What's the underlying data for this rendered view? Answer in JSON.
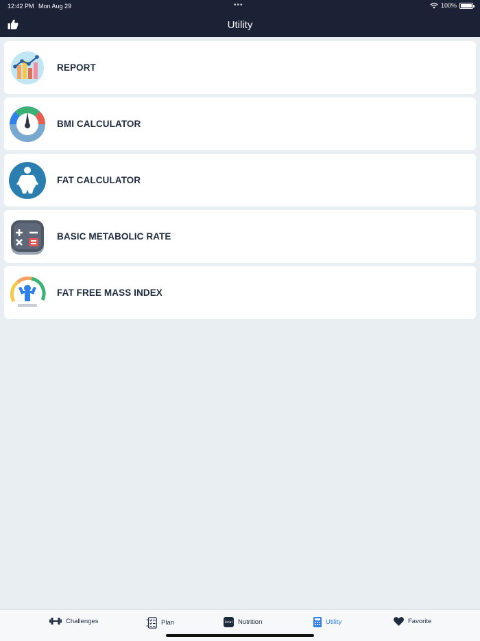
{
  "status": {
    "time": "12:42 PM",
    "date": "Mon Aug 29",
    "battery": "100%"
  },
  "header": {
    "title": "Utility"
  },
  "items": [
    {
      "label": "REPORT",
      "icon": "report-chart-icon"
    },
    {
      "label": "BMI CALCULATOR",
      "icon": "bmi-gauge-icon"
    },
    {
      "label": "FAT CALCULATOR",
      "icon": "body-fat-icon"
    },
    {
      "label": "BASIC METABOLIC RATE",
      "icon": "calculator-icon"
    },
    {
      "label": "FAT FREE MASS INDEX",
      "icon": "ffmi-gauge-icon"
    }
  ],
  "tabs": [
    {
      "label": "Challenges",
      "icon": "dumbbell-icon"
    },
    {
      "label": "Plan",
      "icon": "checklist-icon"
    },
    {
      "label": "Nutrition",
      "icon": "kcal-icon",
      "icon_text": "kcal"
    },
    {
      "label": "Utility",
      "icon": "calculator-tab-icon",
      "active": true
    },
    {
      "label": "Favorite",
      "icon": "heart-icon"
    }
  ],
  "colors": {
    "header": "#1b2236",
    "background": "#e9eef2",
    "active_tab": "#2f80ed",
    "label": "#1e2a3e"
  }
}
